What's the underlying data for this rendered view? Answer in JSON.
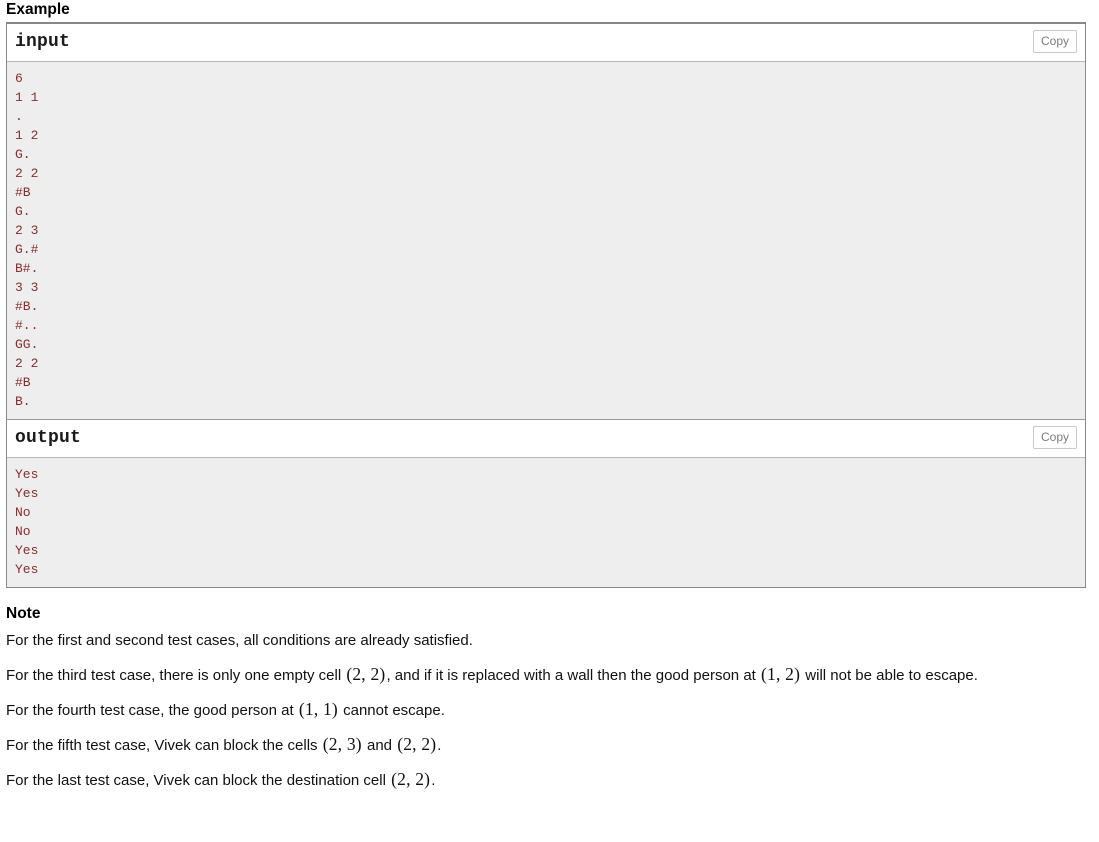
{
  "example": {
    "heading": "Example",
    "blocks": [
      {
        "title": "input",
        "copy_label": "Copy",
        "content": "6\n1 1\n.\n1 2\nG.\n2 2\n#B\nG.\n2 3\nG.#\nB#.\n3 3\n#B.\n#..\nGG.\n2 2\n#B\nB."
      },
      {
        "title": "output",
        "copy_label": "Copy",
        "content": "Yes\nYes\nNo\nNo\nYes\nYes"
      }
    ]
  },
  "note": {
    "heading": "Note",
    "paragraphs": [
      {
        "parts": [
          {
            "type": "text",
            "value": "For the first and second test cases, all conditions are already satisfied."
          }
        ]
      },
      {
        "parts": [
          {
            "type": "text",
            "value": "For the third test case, there is only one empty cell "
          },
          {
            "type": "math",
            "value": "(2, 2)"
          },
          {
            "type": "text",
            "value": ", and if it is replaced with a wall then the good person at "
          },
          {
            "type": "math",
            "value": "(1, 2)"
          },
          {
            "type": "text",
            "value": " will not be able to escape."
          }
        ]
      },
      {
        "parts": [
          {
            "type": "text",
            "value": "For the fourth test case, the good person at "
          },
          {
            "type": "math",
            "value": "(1, 1)"
          },
          {
            "type": "text",
            "value": " cannot escape."
          }
        ]
      },
      {
        "parts": [
          {
            "type": "text",
            "value": "For the fifth test case, Vivek can block the cells "
          },
          {
            "type": "math",
            "value": "(2, 3)"
          },
          {
            "type": "text",
            "value": " and "
          },
          {
            "type": "math",
            "value": "(2, 2)"
          },
          {
            "type": "text",
            "value": "."
          }
        ]
      },
      {
        "parts": [
          {
            "type": "text",
            "value": "For the last test case, Vivek can block the destination cell "
          },
          {
            "type": "math",
            "value": "(2, 2)"
          },
          {
            "type": "text",
            "value": "."
          }
        ]
      }
    ]
  },
  "colors": {
    "sample_text": "#8b2c2c",
    "sample_bg": "#eeeeee",
    "border": "#888888",
    "copy_text": "#7d7d7d"
  }
}
